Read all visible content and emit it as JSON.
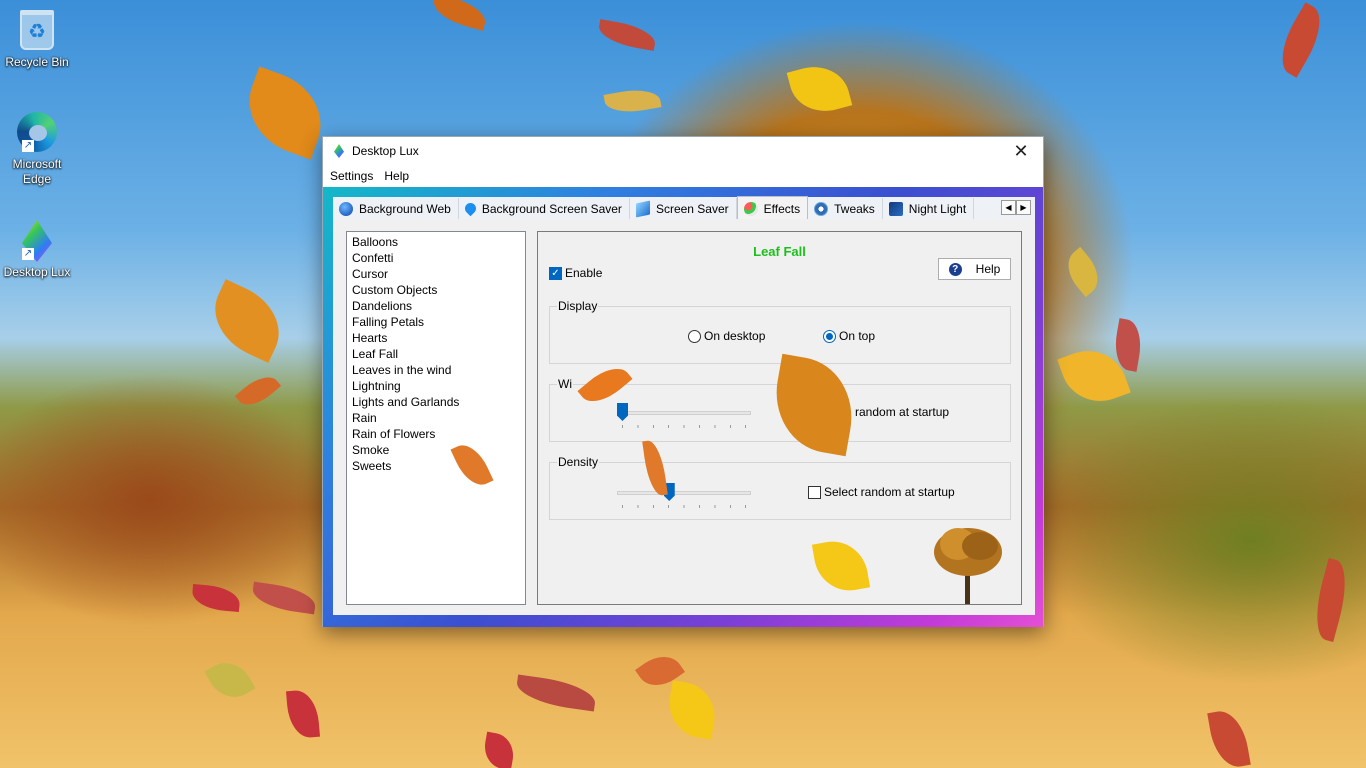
{
  "desktop": {
    "icons": [
      {
        "label": "Recycle Bin"
      },
      {
        "label": "Microsoft Edge"
      },
      {
        "label": "Desktop Lux"
      }
    ]
  },
  "window": {
    "title": "Desktop Lux",
    "close_glyph": "✕",
    "menu": [
      "Settings",
      "Help"
    ],
    "tabs": [
      {
        "label": "Background Web",
        "icon": "globe-icon"
      },
      {
        "label": "Background Screen Saver",
        "icon": "water-drop-icon"
      },
      {
        "label": "Screen Saver",
        "icon": "monitor-icon"
      },
      {
        "label": "Effects",
        "icon": "balloons-icon",
        "active": true
      },
      {
        "label": "Tweaks",
        "icon": "gear-icon"
      },
      {
        "label": "Night Light",
        "icon": "night-icon"
      }
    ],
    "tab_scroll": {
      "left": "◀",
      "right": "▶"
    }
  },
  "effects_list": [
    "Balloons",
    "Confetti",
    "Cursor",
    "Custom Objects",
    "Dandelions",
    "Falling Petals",
    "Hearts",
    "Leaf Fall",
    "Leaves in the wind",
    "Lightning",
    "Lights and Garlands",
    "Rain",
    "Rain of Flowers",
    "Smoke",
    "Sweets"
  ],
  "effect": {
    "title": "Leaf Fall",
    "enable_label": "Enable",
    "enable_checked": true,
    "help_label": "Help",
    "help_glyph": "?",
    "check_glyph": "✓",
    "display": {
      "label": "Display",
      "options": [
        "On desktop",
        "On top"
      ],
      "selected": "On top"
    },
    "wind": {
      "label": "Wi",
      "random_label": "random at startup",
      "level": 0.0
    },
    "density": {
      "label": "Density",
      "random_label": "Select random at startup",
      "random_checked": false,
      "level": 0.38
    }
  },
  "colors": {
    "accent": "#0067c0",
    "title_green": "#1dbf1d"
  }
}
